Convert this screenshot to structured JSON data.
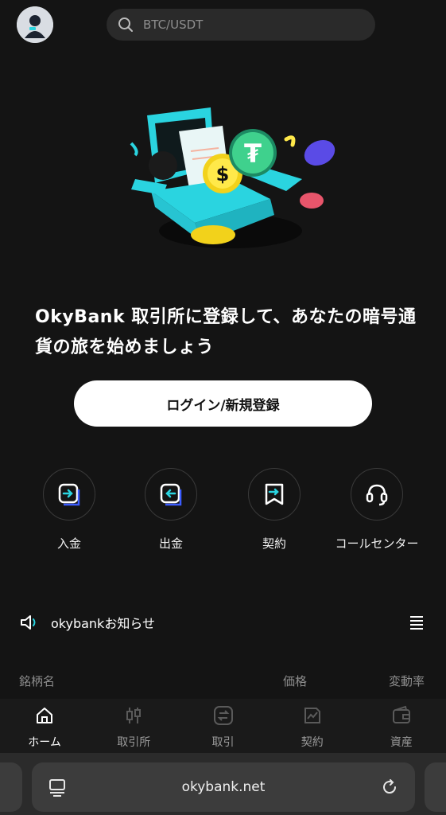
{
  "search": {
    "placeholder": "BTC/USDT"
  },
  "hero": {
    "headline": "OkyBank 取引所に登録して、あなたの暗号通貨の旅を始めましょう"
  },
  "cta": {
    "label": "ログイン/新規登録"
  },
  "quick_actions": [
    {
      "label": "入金",
      "icon": "deposit-icon"
    },
    {
      "label": "出金",
      "icon": "withdraw-icon"
    },
    {
      "label": "契約",
      "icon": "contract-icon"
    },
    {
      "label": "コールセンター",
      "icon": "headset-icon"
    }
  ],
  "notice": {
    "text": "okybankお知らせ"
  },
  "list_header": {
    "name": "銘柄名",
    "price": "価格",
    "change": "変動率"
  },
  "bottom_nav": [
    {
      "label": "ホーム",
      "icon": "home-icon",
      "active": true
    },
    {
      "label": "取引所",
      "icon": "candlestick-icon",
      "active": false
    },
    {
      "label": "取引",
      "icon": "swap-icon",
      "active": false
    },
    {
      "label": "契約",
      "icon": "contract-chart-icon",
      "active": false
    },
    {
      "label": "資産",
      "icon": "wallet-icon",
      "active": false
    }
  ],
  "browser": {
    "url": "okybank.net"
  },
  "colors": {
    "background": "#141414",
    "accent_cyan": "#2ad4e0",
    "cta_bg": "#ffffff"
  }
}
